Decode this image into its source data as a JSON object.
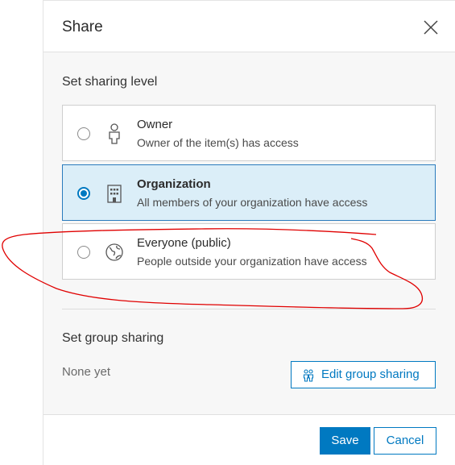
{
  "dialog": {
    "title": "Share",
    "close_icon": "close-icon"
  },
  "sharing_level": {
    "label": "Set sharing level",
    "options": [
      {
        "title": "Owner",
        "description": "Owner of the item(s) has access",
        "icon": "person-icon",
        "selected": false
      },
      {
        "title": "Organization",
        "description": "All members of your organization have access",
        "icon": "building-icon",
        "selected": true
      },
      {
        "title": "Everyone (public)",
        "description": "People outside your organization have access",
        "icon": "globe-icon",
        "selected": false
      }
    ]
  },
  "group_sharing": {
    "label": "Set group sharing",
    "empty_text": "None yet",
    "edit_button_label": "Edit group sharing",
    "edit_icon": "groups-icon"
  },
  "footer": {
    "save_label": "Save",
    "cancel_label": "Cancel"
  },
  "colors": {
    "accent": "#0079c1",
    "selected_background": "#dbeef8",
    "annotation": "#e00000"
  }
}
